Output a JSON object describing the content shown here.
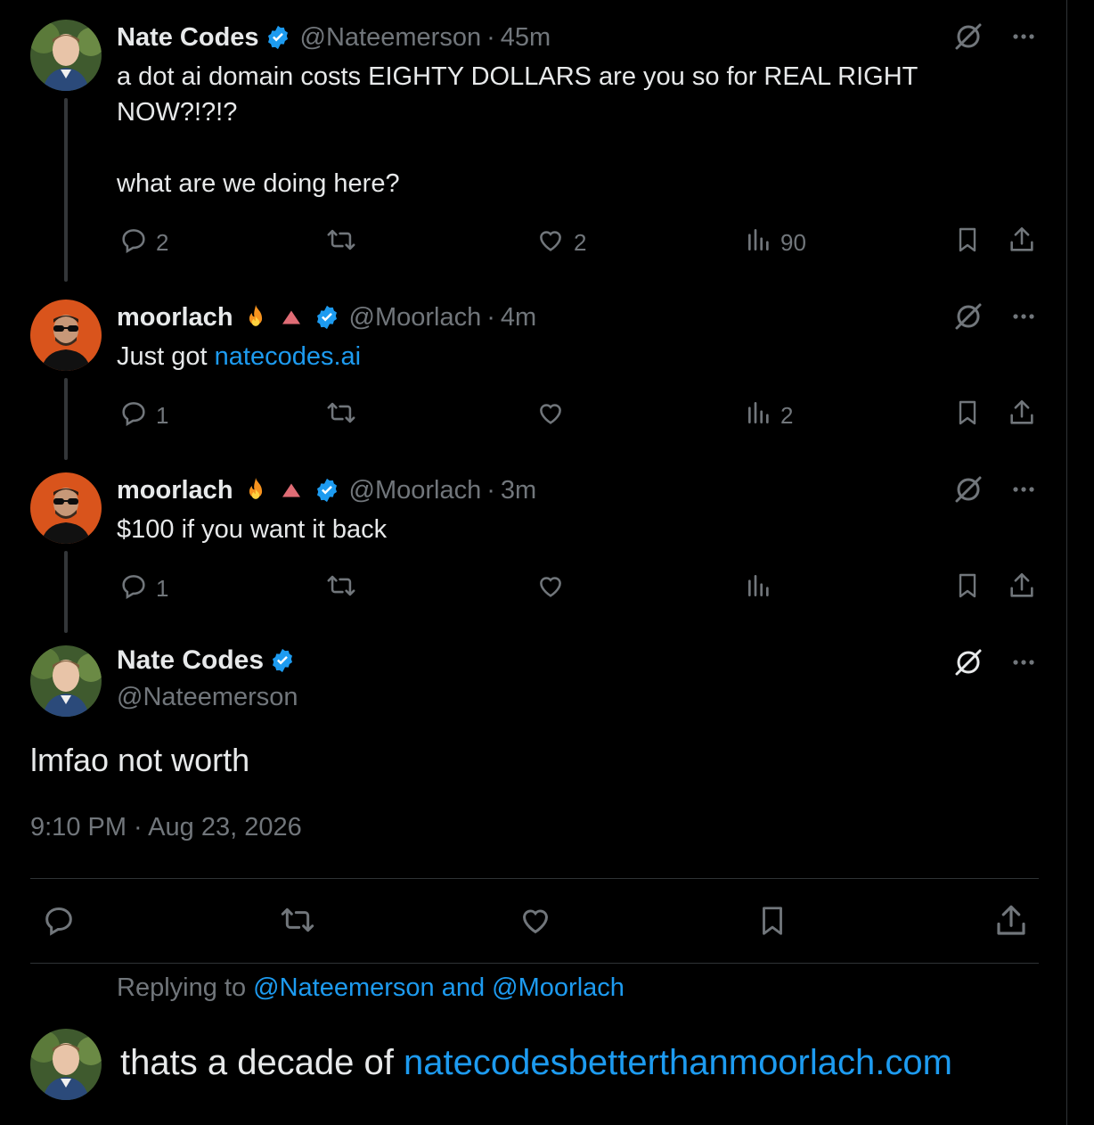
{
  "tweets": [
    {
      "name": "Nate Codes",
      "handle": "@Nateemerson",
      "time": "45m",
      "text": "a dot ai domain costs EIGHTY DOLLARS are you so for REAL RIGHT\nNOW?!?!?\n\nwhat are we doing here?",
      "replies": "2",
      "reposts": "",
      "likes": "2",
      "views": "90"
    },
    {
      "name": "moorlach",
      "handle": "@Moorlach",
      "time": "4m",
      "text_prefix": "Just got ",
      "text_link": "natecodes.ai",
      "replies": "1",
      "reposts": "",
      "likes": "",
      "views": "2"
    },
    {
      "name": "moorlach",
      "handle": "@Moorlach",
      "time": "3m",
      "text": "$100 if you want it back",
      "replies": "1",
      "reposts": "",
      "likes": "",
      "views": ""
    }
  ],
  "main_tweet": {
    "name": "Nate Codes",
    "handle": "@Nateemerson",
    "text": "lmfao not worth",
    "timestamp": "9:10 PM · Aug 23, 2026"
  },
  "reply_box": {
    "replying_prefix": "Replying to ",
    "replying_to": "@Nateemerson and @Moorlach",
    "text_prefix": "thats a decade of ",
    "text_link": "natecodesbetterthanmoorlach.com"
  },
  "colors": {
    "accent": "#1d9bf0",
    "muted": "#71767b",
    "background": "#000000"
  },
  "icons": [
    "verified-badge-icon",
    "fire-emoji",
    "red-triangle-emoji",
    "grok-icon",
    "more-icon",
    "reply-icon",
    "repost-icon",
    "like-icon",
    "views-icon",
    "bookmark-icon",
    "share-icon"
  ]
}
